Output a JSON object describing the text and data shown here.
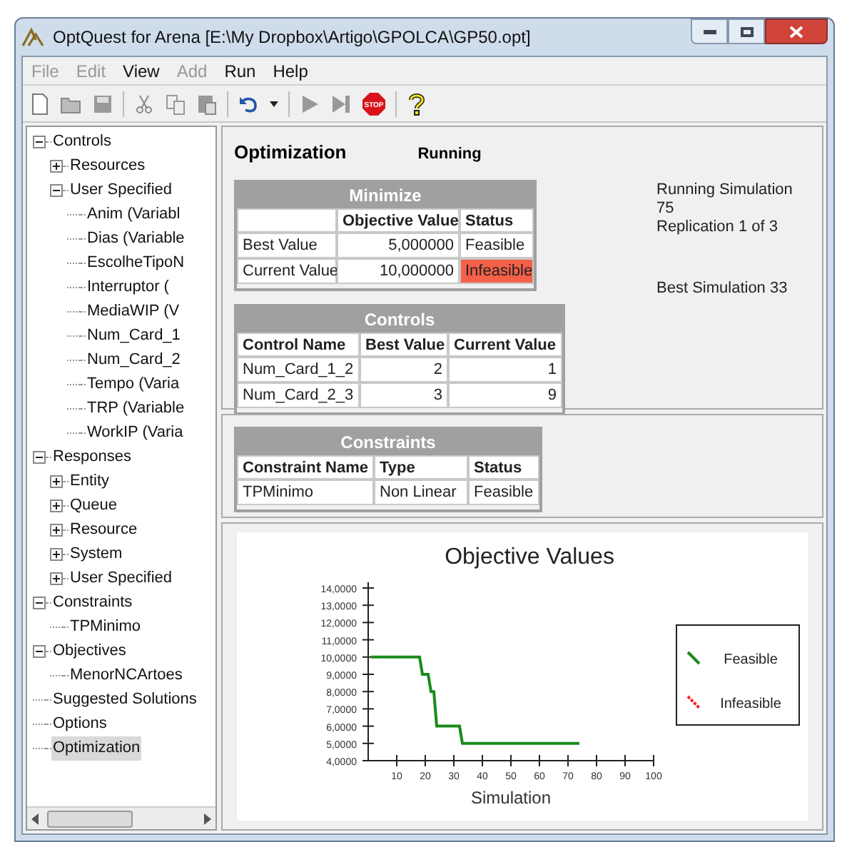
{
  "window": {
    "title": "OptQuest for Arena  [E:\\My Dropbox\\Artigo\\GPOLCA\\GP50.opt]"
  },
  "menu": [
    {
      "label": "File",
      "disabled": true
    },
    {
      "label": "Edit",
      "disabled": true
    },
    {
      "label": "View",
      "disabled": false
    },
    {
      "label": "Add",
      "disabled": true
    },
    {
      "label": "Run",
      "disabled": false
    },
    {
      "label": "Help",
      "disabled": false
    }
  ],
  "toolbar": {
    "stop_label": "STOP"
  },
  "tree": [
    {
      "label": "Controls",
      "expanded": true,
      "selected": false,
      "children": [
        {
          "label": "Resources",
          "expanded": false,
          "selected": false
        },
        {
          "label": "User Specified",
          "expanded": true,
          "selected": false,
          "children": [
            {
              "label": "Anim (Variabl",
              "selected": false
            },
            {
              "label": "Dias (Variable",
              "selected": false
            },
            {
              "label": "EscolheTipoN",
              "selected": false
            },
            {
              "label": "Interruptor (",
              "selected": false
            },
            {
              "label": "MediaWIP (V",
              "selected": false
            },
            {
              "label": "Num_Card_1",
              "selected": false
            },
            {
              "label": "Num_Card_2",
              "selected": false
            },
            {
              "label": "Tempo (Varia",
              "selected": false
            },
            {
              "label": "TRP (Variable",
              "selected": false
            },
            {
              "label": "WorkIP (Varia",
              "selected": false
            }
          ]
        }
      ]
    },
    {
      "label": "Responses",
      "expanded": true,
      "selected": false,
      "children": [
        {
          "label": "Entity",
          "expanded": false,
          "selected": false
        },
        {
          "label": "Queue",
          "expanded": false,
          "selected": false
        },
        {
          "label": "Resource",
          "expanded": false,
          "selected": false
        },
        {
          "label": "System",
          "expanded": false,
          "selected": false
        },
        {
          "label": "User Specified",
          "expanded": false,
          "selected": false
        }
      ]
    },
    {
      "label": "Constraints",
      "expanded": true,
      "selected": false,
      "children": [
        {
          "label": "TPMinimo",
          "selected": false
        }
      ]
    },
    {
      "label": "Objectives",
      "expanded": true,
      "selected": false,
      "children": [
        {
          "label": "MenorNCArtoes",
          "selected": false
        }
      ]
    },
    {
      "label": "Suggested Solutions",
      "selected": false
    },
    {
      "label": "Options",
      "selected": false
    },
    {
      "label": "Optimization",
      "selected": true
    }
  ],
  "optimization": {
    "title": "Optimization",
    "state": "Running",
    "minimize": {
      "title": "Minimize",
      "columns": [
        "",
        "Objective Value",
        "Status"
      ],
      "rows": [
        {
          "cells": [
            "Best Value",
            "5,000000",
            "Feasible"
          ],
          "alert": false
        },
        {
          "cells": [
            "Current Value",
            "10,000000",
            "Infeasible"
          ],
          "alert": true
        }
      ]
    },
    "controls": {
      "title": "Controls",
      "columns": [
        "Control Name",
        "Best Value",
        "Current Value"
      ],
      "rows": [
        {
          "cells": [
            "Num_Card_1_2",
            "2",
            "1"
          ]
        },
        {
          "cells": [
            "Num_Card_2_3",
            "3",
            "9"
          ]
        }
      ]
    },
    "status_lines": [
      "Running Simulation",
      "75",
      "Replication 1 of 3"
    ],
    "best": "Best Simulation 33"
  },
  "constraints": {
    "title": "Constraints",
    "columns": [
      "Constraint Name",
      "Type",
      "Status"
    ],
    "rows": [
      {
        "cells": [
          "TPMinimo",
          "Non Linear",
          "Feasible"
        ]
      }
    ]
  },
  "chart": {
    "title": "Objective Values",
    "xlabel": "Simulation",
    "legend": [
      {
        "name": "Feasible",
        "color": "#1a8a1a"
      },
      {
        "name": "Infeasible",
        "color": "#ff2020"
      }
    ],
    "x_labels": [
      "10",
      "20",
      "30",
      "40",
      "50",
      "60",
      "70",
      "80",
      "90",
      "100"
    ],
    "y_labels": [
      "14,0000",
      "13,0000",
      "12,0000",
      "11,0000",
      "10,0000",
      "9,0000",
      "8,0000",
      "7,0000",
      "6,0000",
      "5,0000",
      "4,0000"
    ]
  }
}
